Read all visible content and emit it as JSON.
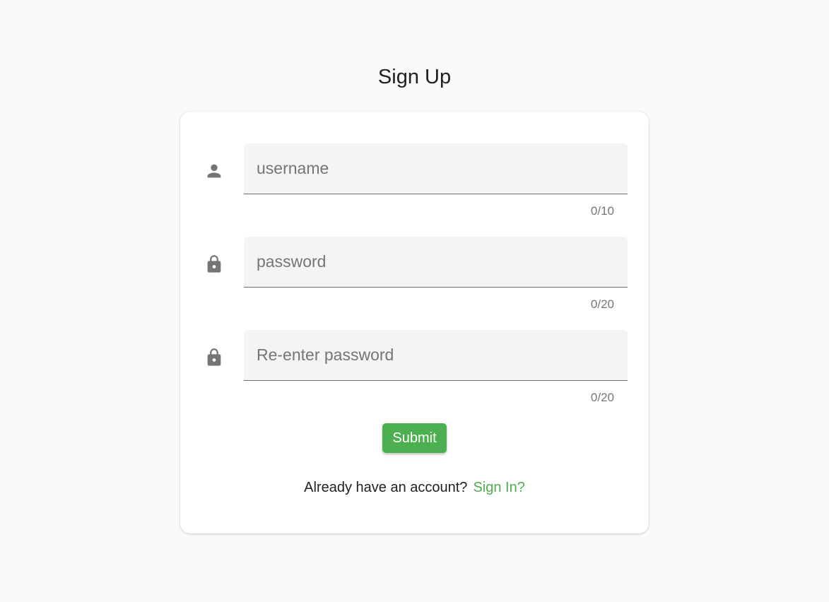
{
  "page": {
    "title": "Sign Up"
  },
  "form": {
    "fields": [
      {
        "icon": "person-icon",
        "placeholder": "username",
        "value": "",
        "counter": "0/10"
      },
      {
        "icon": "lock-icon",
        "placeholder": "password",
        "value": "",
        "counter": "0/20"
      },
      {
        "icon": "lock-icon",
        "placeholder": "Re-enter password",
        "value": "",
        "counter": "0/20"
      }
    ],
    "submit_label": "Submit"
  },
  "footer": {
    "prompt": "Already have an account?",
    "link_label": "Sign In?"
  },
  "colors": {
    "accent": "#4caf50",
    "background": "#fafafa",
    "icon": "#757575"
  }
}
